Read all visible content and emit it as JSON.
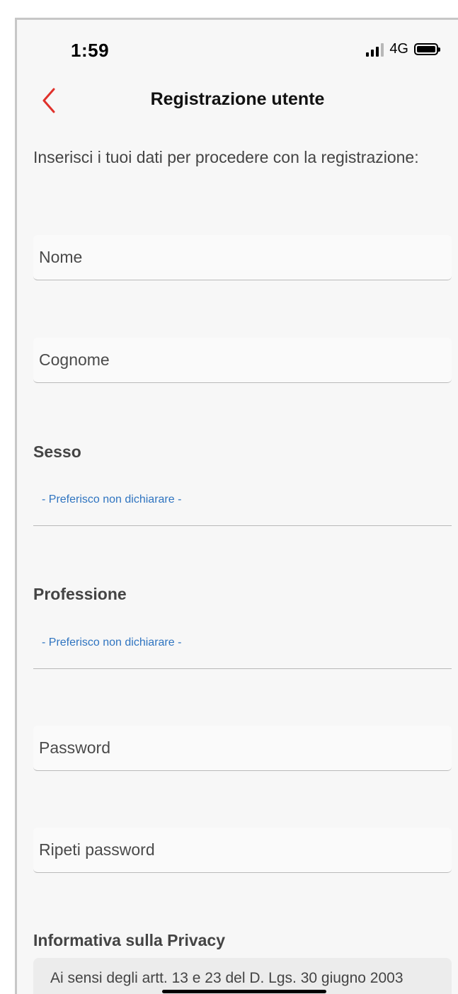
{
  "status_bar": {
    "time": "1:59",
    "network": "4G",
    "signal_icon": "cellular-signal-icon",
    "battery_icon": "battery-icon"
  },
  "nav": {
    "back_icon": "chevron-left-icon",
    "title": "Registrazione utente"
  },
  "intro": "Inserisci i tuoi dati per procedere con la registrazione:",
  "form": {
    "nome_placeholder": "Nome",
    "cognome_placeholder": "Cognome",
    "sesso_label": "Sesso",
    "sesso_value": "- Preferisco non dichiarare -",
    "professione_label": "Professione",
    "professione_value": "- Preferisco non dichiarare -",
    "password_placeholder": "Password",
    "repeat_password_placeholder": "Ripeti password"
  },
  "privacy": {
    "title": "Informativa sulla Privacy",
    "text": "Ai sensi degli artt. 13 e 23 del D. Lgs. 30 giugno 2003"
  },
  "colors": {
    "accent": "#e0312b",
    "link": "#2f74c0"
  }
}
